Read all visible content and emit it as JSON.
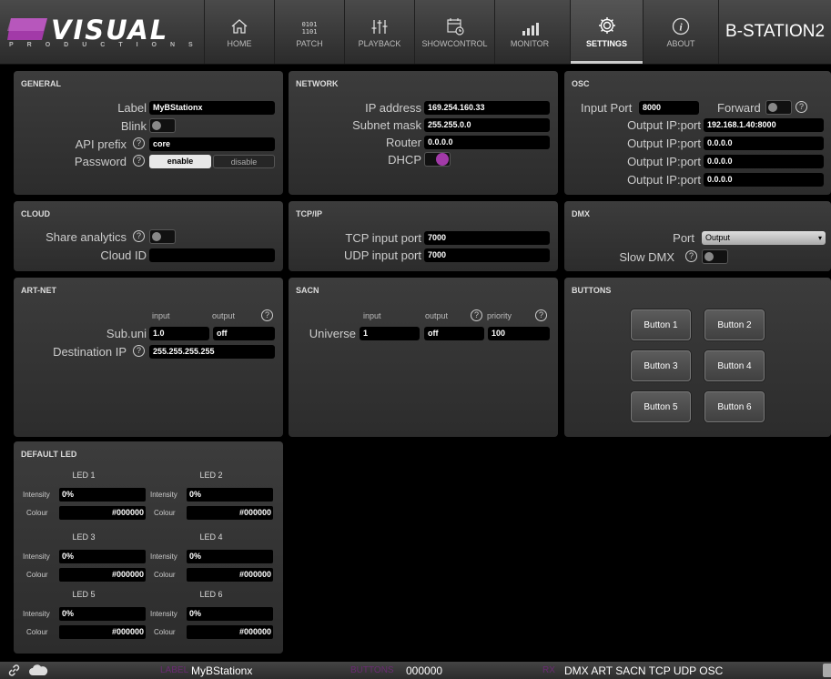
{
  "logo": {
    "word": "VISUAL",
    "sub": "PRODUCTIONS"
  },
  "nav": [
    {
      "label": "HOME",
      "icon": "home-icon"
    },
    {
      "label": "PATCH",
      "icon": "binary-icon",
      "glyph": "0101\n1101"
    },
    {
      "label": "PLAYBACK",
      "icon": "faders-icon"
    },
    {
      "label": "SHOWCONTROL",
      "icon": "calendar-clock-icon"
    },
    {
      "label": "MONITOR",
      "icon": "signal-bars-icon"
    },
    {
      "label": "SETTINGS",
      "icon": "gear-icon",
      "active": true
    },
    {
      "label": "ABOUT",
      "icon": "info-icon"
    }
  ],
  "device_title": "B-STATION2",
  "general": {
    "title": "GENERAL",
    "label_lbl": "Label",
    "label_val": "MyBStationx",
    "blink_lbl": "Blink",
    "api_lbl": "API prefix",
    "api_val": "core",
    "password_lbl": "Password",
    "enable": "enable",
    "disable": "disable"
  },
  "network": {
    "title": "NETWORK",
    "ip_lbl": "IP address",
    "ip_val": "169.254.160.33",
    "subnet_lbl": "Subnet mask",
    "subnet_val": "255.255.0.0",
    "router_lbl": "Router",
    "router_val": "0.0.0.0",
    "dhcp_lbl": "DHCP"
  },
  "osc": {
    "title": "OSC",
    "input_lbl": "Input Port",
    "input_val": "8000",
    "forward_lbl": "Forward",
    "outputs": [
      {
        "lbl": "Output IP:port",
        "val": "192.168.1.40:8000"
      },
      {
        "lbl": "Output IP:port",
        "val": "0.0.0.0"
      },
      {
        "lbl": "Output IP:port",
        "val": "0.0.0.0"
      },
      {
        "lbl": "Output IP:port",
        "val": "0.0.0.0"
      }
    ]
  },
  "cloud": {
    "title": "CLOUD",
    "share_lbl": "Share analytics",
    "id_lbl": "Cloud ID",
    "id_val": ""
  },
  "tcpip": {
    "title": "TCP/IP",
    "tcp_lbl": "TCP input port",
    "tcp_val": "7000",
    "udp_lbl": "UDP input port",
    "udp_val": "7000"
  },
  "dmx": {
    "title": "DMX",
    "port_lbl": "Port",
    "port_val": "Output",
    "slow_lbl": "Slow DMX"
  },
  "artnet": {
    "title": "ART-NET",
    "col_input": "input",
    "col_output": "output",
    "subuni_lbl": "Sub.uni",
    "subuni_in": "1.0",
    "subuni_out": "off",
    "dest_lbl": "Destination IP",
    "dest_val": "255.255.255.255"
  },
  "sacn": {
    "title": "SACN",
    "col_input": "input",
    "col_output": "output",
    "col_priority": "priority",
    "universe_lbl": "Universe",
    "in_val": "1",
    "out_val": "off",
    "prio_val": "100"
  },
  "buttons": {
    "title": "BUTTONS",
    "items": [
      "Button 1",
      "Button 2",
      "Button 3",
      "Button 4",
      "Button 5",
      "Button 6"
    ]
  },
  "leds": {
    "title": "DEFAULT LED",
    "intensity_lbl": "Intensity",
    "colour_lbl": "Colour",
    "items": [
      {
        "name": "LED 1",
        "intensity": "0%",
        "colour": "#000000"
      },
      {
        "name": "LED 2",
        "intensity": "0%",
        "colour": "#000000"
      },
      {
        "name": "LED 3",
        "intensity": "0%",
        "colour": "#000000"
      },
      {
        "name": "LED 4",
        "intensity": "0%",
        "colour": "#000000"
      },
      {
        "name": "LED 5",
        "intensity": "0%",
        "colour": "#000000"
      },
      {
        "name": "LED 6",
        "intensity": "0%",
        "colour": "#000000"
      }
    ]
  },
  "status": {
    "label_key": "LABEL",
    "label_val": "MyBStationx",
    "buttons_key": "BUTTONS",
    "buttons_val": "000000",
    "rx_key": "RX",
    "rx_val": "DMX ART SACN TCP UDP OSC"
  },
  "colors": {
    "accent": "#a23aa8",
    "status_key": "#6b2a73",
    "panel": "#333333"
  }
}
